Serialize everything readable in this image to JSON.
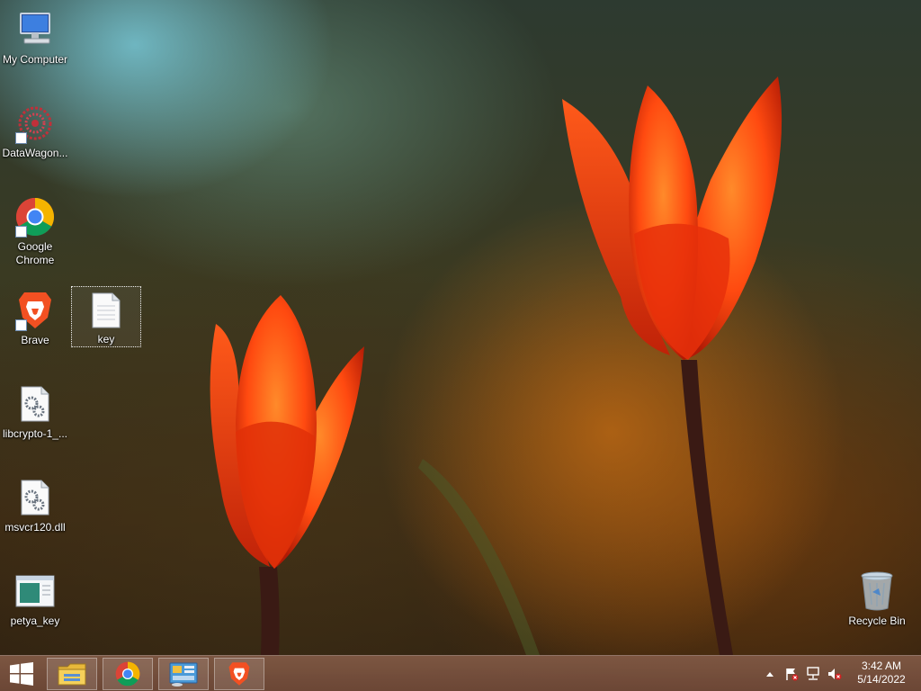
{
  "desktop": {
    "icons": [
      {
        "label": "My Computer"
      },
      {
        "label": "DataWagon..."
      },
      {
        "label": "Google Chrome"
      },
      {
        "label": "Brave"
      },
      {
        "label": "key"
      },
      {
        "label": "libcrypto-1_..."
      },
      {
        "label": "msvcr120.dll"
      },
      {
        "label": "petya_key"
      },
      {
        "label": "Recycle Bin"
      }
    ]
  },
  "taskbar": {
    "start_icon": "windows-logo-icon",
    "pinned": [
      {
        "icon": "file-explorer-icon"
      },
      {
        "icon": "chrome-icon"
      },
      {
        "icon": "control-panel-icon"
      },
      {
        "icon": "brave-icon"
      }
    ],
    "tray": {
      "icons": [
        "show-hidden-icons-chevron",
        "action-center-flag-icon",
        "network-icon",
        "volume-muted-icon"
      ],
      "time": "3:42 AM",
      "date": "5/14/2022"
    }
  },
  "colors": {
    "taskbar": "#7a5040",
    "tulip": "#ff4a10",
    "stem": "#3a1a14"
  }
}
